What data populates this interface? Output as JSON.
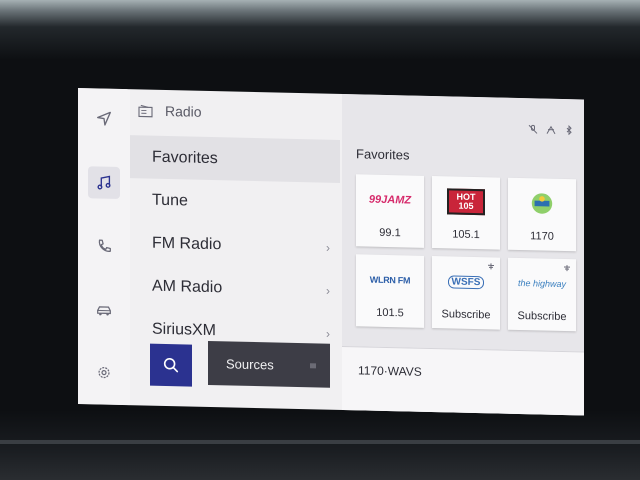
{
  "header": {
    "title": "Radio"
  },
  "menu": {
    "items": [
      {
        "label": "Favorites"
      },
      {
        "label": "Tune"
      },
      {
        "label": "FM Radio"
      },
      {
        "label": "AM Radio"
      },
      {
        "label": "SiriusXM"
      }
    ]
  },
  "buttons": {
    "sources_label": "Sources"
  },
  "favorites": {
    "title": "Favorites",
    "tiles": [
      {
        "logo_text": "99JAMZ",
        "label": "99.1"
      },
      {
        "logo_text": "HOT 105",
        "label": "105.1"
      },
      {
        "logo_text": "",
        "label": "1170"
      },
      {
        "logo_text": "WLRN FM",
        "label": "101.5"
      },
      {
        "logo_text": "WSFS",
        "label": "Subscribe"
      },
      {
        "logo_text": "the highway",
        "label": "Subscribe"
      }
    ]
  },
  "now_playing": {
    "station": "1170·WAVS"
  },
  "colors": {
    "accent": "#2b3290",
    "dark_button": "#3d3d46",
    "screen_bg": "#f1f0f2"
  }
}
